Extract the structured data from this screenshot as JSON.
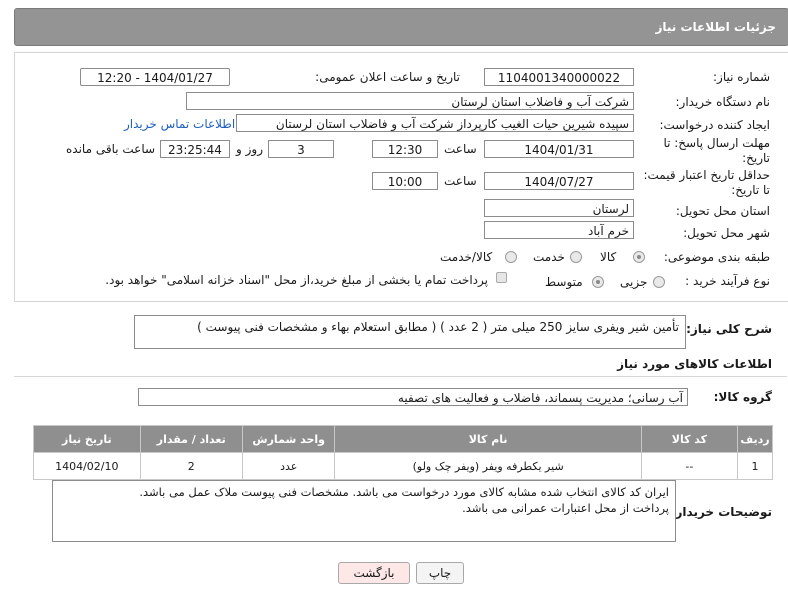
{
  "header": {
    "title": "جزئیات اطلاعات نیاز"
  },
  "form": {
    "need_number": {
      "label": "شماره نیاز:",
      "value": "1104001340000022"
    },
    "announce_datetime": {
      "label": "تاریخ و ساعت اعلان عمومی:",
      "value": "1404/01/27 - 12:20"
    },
    "buyer_org": {
      "label": "نام دستگاه خریدار:",
      "value": "شرکت آب و فاضلاب استان لرستان"
    },
    "requester": {
      "label": "ایجاد کننده درخواست:",
      "value": "سپیده شیرین حیات الغیب کارپرداز شرکت آب و فاضلاب استان لرستان",
      "contact_link": "اطلاعات تماس خریدار"
    },
    "reply_deadline": {
      "label_line1": "مهلت ارسال پاسخ: تا",
      "label_line2": "تاریخ:",
      "date": "1404/01/31",
      "time_label": "ساعت",
      "time": "12:30",
      "days": "3",
      "days_label": "روز و",
      "remaining": "23:25:44",
      "remaining_label": "ساعت باقی مانده"
    },
    "price_validity": {
      "label_line1": "حداقل تاریخ اعتبار قیمت:",
      "label_line2": "تا تاریخ:",
      "date": "1404/07/27",
      "time_label": "ساعت",
      "time": "10:00"
    },
    "delivery_province": {
      "label": "استان محل تحویل:",
      "value": "لرستان"
    },
    "delivery_city": {
      "label": "شهر محل تحویل:",
      "value": "خرم آباد"
    },
    "category": {
      "label": "طبقه بندی موضوعی:",
      "options": [
        "کالا",
        "خدمت",
        "کالا/خدمت"
      ],
      "selected": "کالا"
    },
    "purchase_type": {
      "label": "نوع فرآیند خرید :",
      "options": [
        "جزیی",
        "متوسط"
      ],
      "selected": "متوسط",
      "checkbox_text": "پرداخت تمام یا بخشی از مبلغ خرید،از محل \"اسناد خزانه اسلامی\" خواهد بود."
    }
  },
  "description": {
    "label": "شرح کلی نیاز:",
    "value": "تأمین شیر ویفری سایز 250 میلی متر ( 2 عدد ) ( مطابق استعلام بهاء و مشخصات فنی پیوست )"
  },
  "goods_info": {
    "title": "اطلاعات کالاهای مورد نیاز"
  },
  "goods_group": {
    "label": "گروه کالا:",
    "value": "آب رسانی؛ مدیریت پسماند، فاضلاب و فعالیت های تصفیه"
  },
  "table": {
    "headers": [
      "ردیف",
      "کد کالا",
      "نام کالا",
      "واحد شمارش",
      "تعداد / مقدار",
      "تاریخ نیاز"
    ],
    "rows": [
      [
        "1",
        "--",
        "شیر یکطرفه ویفر (ویفر چک ولو)",
        "عدد",
        "2",
        "1404/02/10"
      ]
    ]
  },
  "buyer_notes": {
    "label": "توضیحات خریدار:",
    "lines": [
      "ایران کد کالای انتخاب شده مشابه کالای مورد درخواست می باشد. مشخصات فنی پیوست ملاک عمل می باشد.",
      "پرداخت از محل اعتبارات عمرانی می باشد."
    ]
  },
  "buttons": {
    "print": "چاپ",
    "back": "بازگشت"
  },
  "colors": {
    "header_bg": "#949494",
    "link": "#1f5fbf",
    "back_button_bg": "#fde7e7"
  }
}
